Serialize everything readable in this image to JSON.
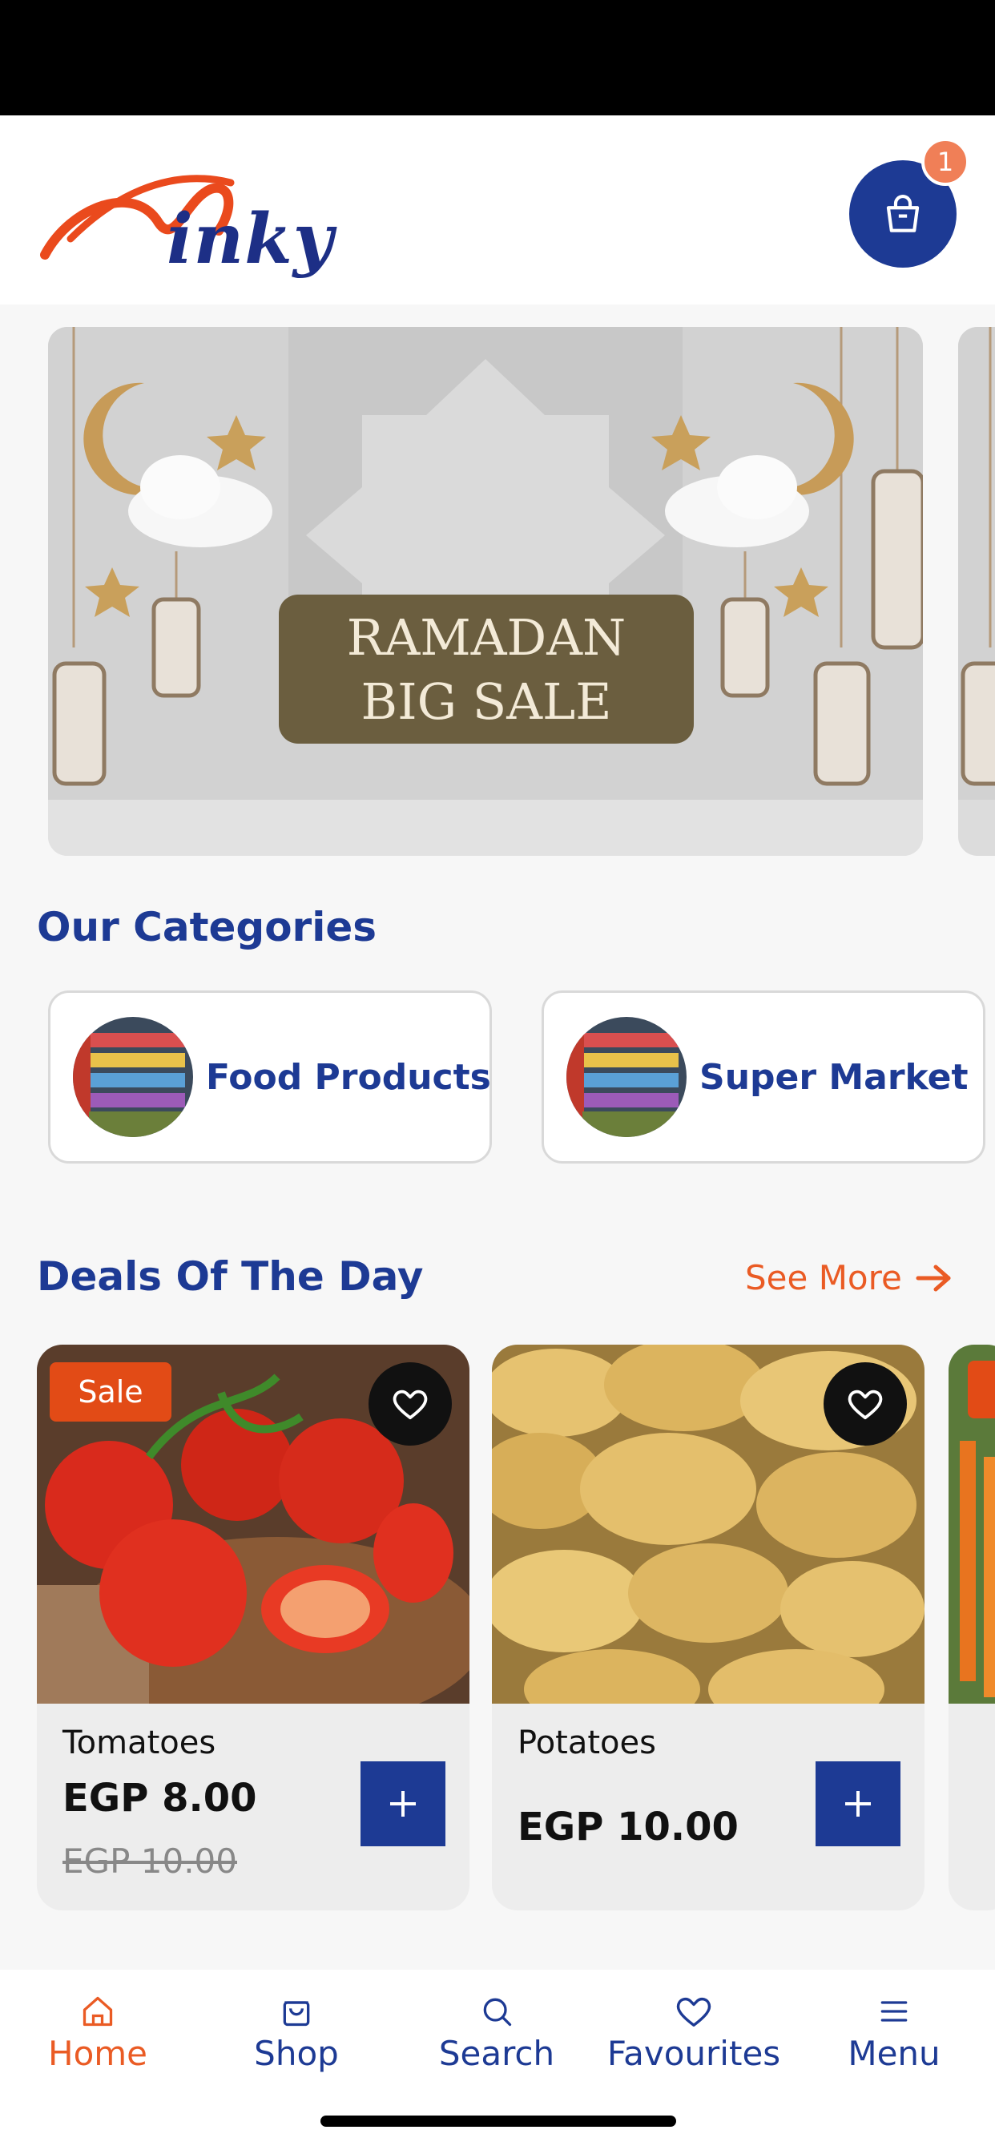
{
  "app": {
    "brand": "inky",
    "cart_count": "1"
  },
  "banner": {
    "line1": "RAMADAN",
    "line2": "BIG SALE"
  },
  "categories": {
    "title": "Our Categories",
    "items": [
      {
        "label": "Food Products"
      },
      {
        "label": "Super Market"
      }
    ]
  },
  "deals": {
    "title": "Deals Of The Day",
    "see_more": "See More",
    "items": [
      {
        "name": "Tomatoes",
        "price": "EGP 8.00",
        "old_price": "EGP 10.00",
        "badge": "Sale"
      },
      {
        "name": "Potatoes",
        "price": "EGP 10.00"
      }
    ]
  },
  "nav": {
    "items": [
      {
        "label": "Home",
        "icon": "home-icon"
      },
      {
        "label": "Shop",
        "icon": "shopping-bag-icon"
      },
      {
        "label": "Search",
        "icon": "search-icon"
      },
      {
        "label": "Favourites",
        "icon": "heart-icon"
      },
      {
        "label": "Menu",
        "icon": "menu-icon"
      }
    ]
  },
  "colors": {
    "primary": "#1d3a94",
    "accent": "#ea5b24",
    "sale": "#e24b16"
  }
}
